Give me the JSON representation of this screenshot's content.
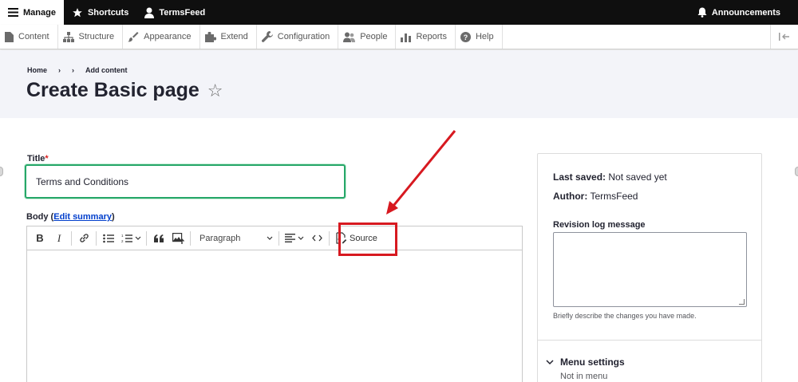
{
  "toolbar": {
    "manage": "Manage",
    "shortcuts": "Shortcuts",
    "user": "TermsFeed",
    "announcements": "Announcements"
  },
  "tray": {
    "items": [
      "Content",
      "Structure",
      "Appearance",
      "Extend",
      "Configuration",
      "People",
      "Reports",
      "Help"
    ]
  },
  "header": {
    "breadcrumb": [
      "Home",
      "›",
      "›",
      "Add content"
    ],
    "title": "Create Basic page",
    "star": "☆"
  },
  "form": {
    "title_label": "Title",
    "required_mark": "*",
    "title_value": "Terms and Conditions",
    "body_label": "Body (",
    "edit_summary": "Edit summary",
    "body_label_end": ")"
  },
  "editor": {
    "bold": "B",
    "italic": "I",
    "paragraph": "Paragraph",
    "source": "Source"
  },
  "sidebar": {
    "last_saved_label": "Last saved:",
    "last_saved_value": "Not saved yet",
    "author_label": "Author:",
    "author_value": "TermsFeed",
    "revision_label": "Revision log message",
    "revision_help": "Briefly describe the changes you have made.",
    "menu_settings": "Menu settings",
    "menu_status": "Not in menu"
  },
  "colors": {
    "highlight": "#d71920",
    "focus_border": "#26a769",
    "link": "#003ecc"
  }
}
